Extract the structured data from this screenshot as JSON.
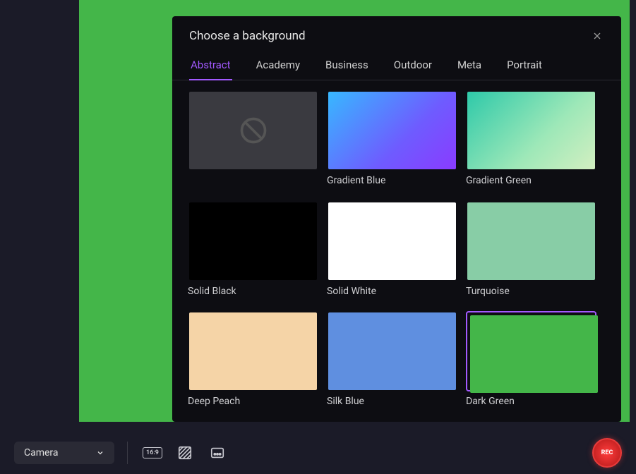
{
  "dialog": {
    "title": "Choose a background",
    "tabs": [
      "Abstract",
      "Academy",
      "Business",
      "Outdoor",
      "Meta",
      "Portrait"
    ],
    "active_tab": 0,
    "backgrounds": {
      "none_label": "",
      "items": [
        {
          "label": "Gradient Blue"
        },
        {
          "label": "Gradient Green"
        },
        {
          "label": "Solid Black"
        },
        {
          "label": "Solid White"
        },
        {
          "label": "Turquoise"
        },
        {
          "label": "Deep Peach"
        },
        {
          "label": "Silk Blue"
        },
        {
          "label": "Dark Green"
        }
      ],
      "selected": "Dark Green"
    }
  },
  "bottom": {
    "source": "Camera",
    "ratio": "16:9",
    "rec_label": "REC"
  }
}
